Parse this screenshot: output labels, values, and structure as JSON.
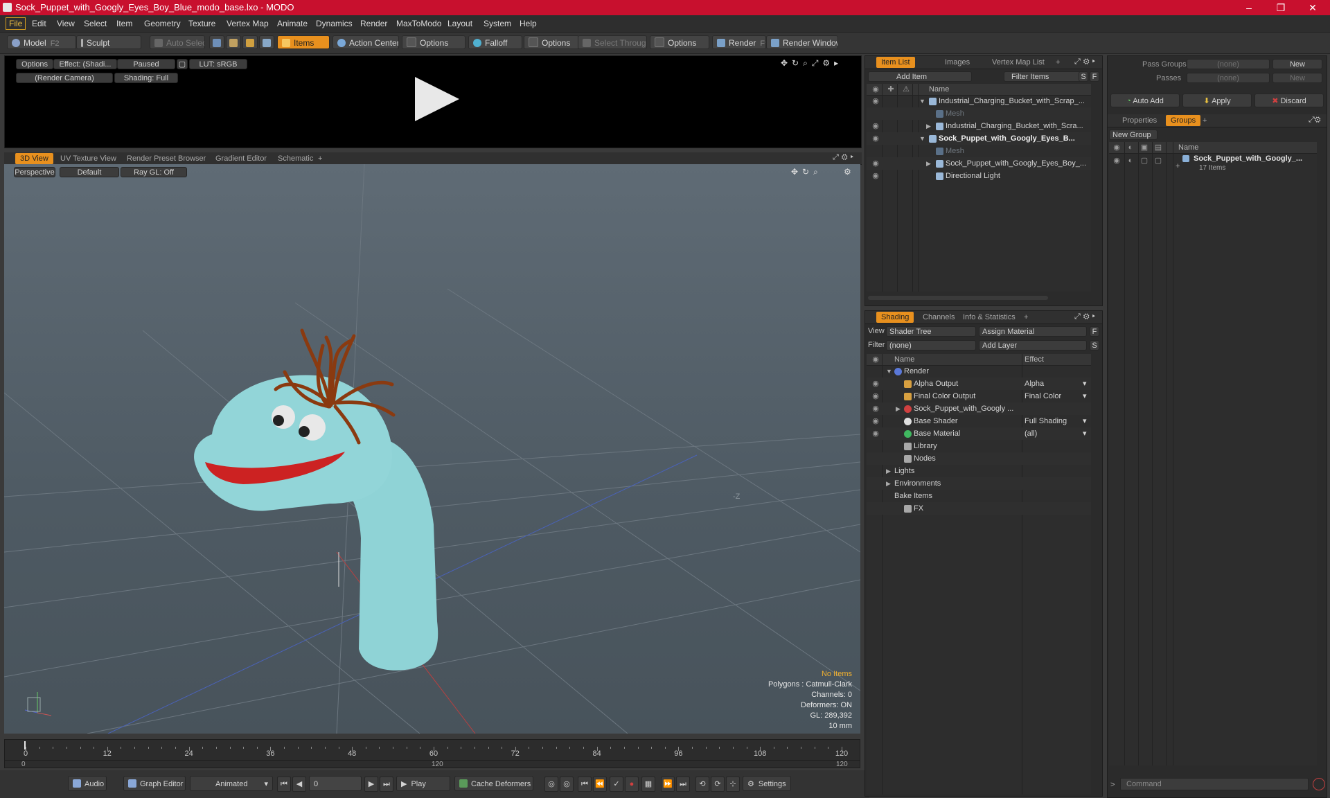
{
  "window": {
    "title": "Sock_Puppet_with_Googly_Eyes_Boy_Blue_modo_base.lxo - MODO",
    "minimize": "–",
    "maximize": "❐",
    "close": "✕"
  },
  "menu": [
    "File",
    "Edit",
    "View",
    "Select",
    "Item",
    "Geometry",
    "Texture",
    "Vertex Map",
    "Animate",
    "Dynamics",
    "Render",
    "MaxToModo",
    "Layout",
    "System",
    "Help"
  ],
  "toolbar": {
    "model": "Model",
    "model_key": "F2",
    "sculpt": "Sculpt",
    "auto_select": "Auto Select",
    "items": "Items",
    "action_center": "Action Center",
    "options1": "Options",
    "falloff": "Falloff",
    "options2": "Options",
    "select_through": "Select Through",
    "options3": "Options",
    "render": "Render",
    "render_key": "F9",
    "render_window": "Render Window"
  },
  "preview": {
    "options": "Options",
    "effect": "Effect: (Shadi...",
    "paused": "Paused",
    "lut": "LUT: sRGB",
    "camera": "(Render Camera)",
    "shading": "Shading: Full"
  },
  "view_tabs": [
    "3D View",
    "UV Texture View",
    "Render Preset Browser",
    "Gradient Editor",
    "Schematic",
    "+"
  ],
  "viewport": {
    "perspective": "Perspective",
    "default": "Default",
    "raygl": "Ray GL: Off",
    "axis_label": "-Z",
    "info": {
      "no_items": "No Items",
      "polygons": "Polygons : Catmull-Clark",
      "channels": "Channels: 0",
      "deformers": "Deformers: ON",
      "gl": "GL: 289,392",
      "scale": "10 mm"
    },
    "colors": {
      "sock": "#8fd3d6",
      "mouth": "#cc2222",
      "hair": "#8a3a10"
    }
  },
  "timeline": {
    "ticks": [
      0,
      12,
      24,
      36,
      48,
      60,
      72,
      84,
      96,
      108,
      120
    ],
    "start": "0",
    "end": "120",
    "mid": "120"
  },
  "bottombar": {
    "audio": "Audio",
    "graph_editor": "Graph Editor",
    "animated": "Animated",
    "frame": "0",
    "play": "Play",
    "cache_deformers": "Cache Deformers",
    "settings": "Settings"
  },
  "item_list": {
    "tabs": [
      "Item List",
      "Images",
      "Vertex Map List",
      "+"
    ],
    "add_item": "Add Item",
    "filter_items": "Filter Items",
    "s": "S",
    "f": "F",
    "col_name": "Name",
    "rows": [
      {
        "label": "Industrial_Charging_Bucket_with_Scrap_...",
        "indent": 0,
        "caret": "▼",
        "bold": false,
        "dim": false
      },
      {
        "label": "Mesh",
        "indent": 1,
        "caret": "",
        "bold": false,
        "dim": true
      },
      {
        "label": "Industrial_Charging_Bucket_with_Scra...",
        "indent": 1,
        "caret": "▶",
        "bold": false,
        "dim": false
      },
      {
        "label": "Sock_Puppet_with_Googly_Eyes_B...",
        "indent": 0,
        "caret": "▼",
        "bold": true,
        "dim": false
      },
      {
        "label": "Mesh",
        "indent": 1,
        "caret": "",
        "bold": false,
        "dim": true
      },
      {
        "label": "Sock_Puppet_with_Googly_Eyes_Boy_...",
        "indent": 1,
        "caret": "▶",
        "bold": false,
        "dim": false
      },
      {
        "label": "Directional Light",
        "indent": 1,
        "caret": "",
        "bold": false,
        "dim": false
      }
    ]
  },
  "shading": {
    "tabs": [
      "Shading",
      "Channels",
      "Info & Statistics",
      "+"
    ],
    "view_label": "View",
    "view_value": "Shader Tree",
    "assign_material": "Assign Material",
    "filter_label": "Filter",
    "filter_value": "(none)",
    "add_layer": "Add Layer",
    "f": "F",
    "s": "S",
    "col_name": "Name",
    "col_effect": "Effect",
    "rows": [
      {
        "label": "Render",
        "effect": "",
        "indent": 0,
        "caret": "▼",
        "eye": false
      },
      {
        "label": "Alpha Output",
        "effect": "Alpha",
        "indent": 1,
        "caret": "",
        "eye": true
      },
      {
        "label": "Final Color Output",
        "effect": "Final Color",
        "indent": 1,
        "caret": "",
        "eye": true
      },
      {
        "label": "Sock_Puppet_with_Googly ...",
        "effect": "",
        "indent": 1,
        "caret": "▶",
        "eye": true
      },
      {
        "label": "Base Shader",
        "effect": "Full Shading",
        "indent": 1,
        "caret": "",
        "eye": true
      },
      {
        "label": "Base Material",
        "effect": "(all)",
        "indent": 1,
        "caret": "",
        "eye": true
      },
      {
        "label": "Library",
        "effect": "",
        "indent": 1,
        "caret": "",
        "eye": false
      },
      {
        "label": "Nodes",
        "effect": "",
        "indent": 1,
        "caret": "",
        "eye": false
      },
      {
        "label": "Lights",
        "effect": "",
        "indent": 0,
        "caret": "▶",
        "eye": false
      },
      {
        "label": "Environments",
        "effect": "",
        "indent": 0,
        "caret": "▶",
        "eye": false
      },
      {
        "label": "Bake Items",
        "effect": "",
        "indent": 0,
        "caret": "",
        "eye": false
      },
      {
        "label": "FX",
        "effect": "",
        "indent": 1,
        "caret": "",
        "eye": false
      }
    ]
  },
  "groups_panel": {
    "pass_groups_label": "Pass Groups",
    "pass_groups_value": "(none)",
    "new1": "New",
    "passes_label": "Passes",
    "passes_value": "(none)",
    "new2": "New",
    "auto_add": "Auto Add",
    "apply": "Apply",
    "discard": "Discard",
    "tabs": [
      "Properties",
      "Groups",
      "+"
    ],
    "new_group": "New Group",
    "col_name": "Name",
    "group_name": "Sock_Puppet_with_Googly_...",
    "group_count": "17 Items",
    "command_placeholder": "Command"
  }
}
